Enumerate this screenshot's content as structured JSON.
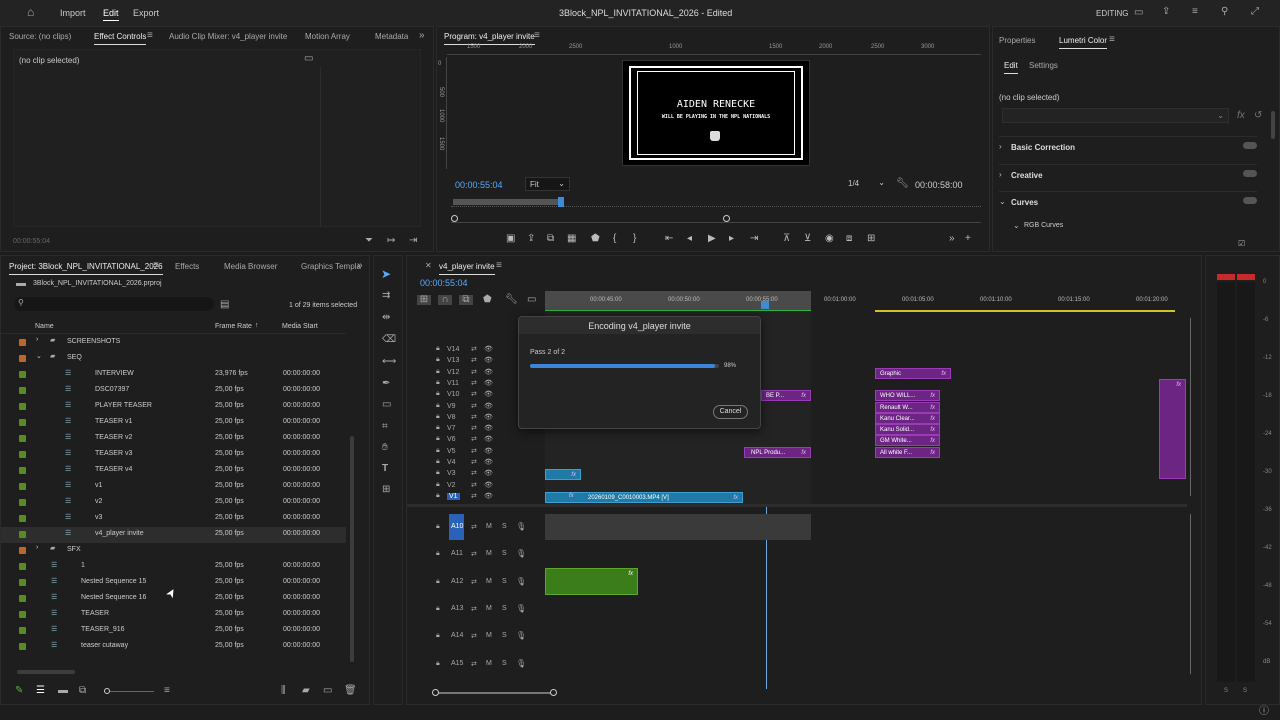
{
  "app": {
    "title": "3Block_NPL_INVITATIONAL_2026 - Edited",
    "menus": [
      "Import",
      "Edit",
      "Export"
    ],
    "active_menu": "Edit",
    "workspace": "EDITING"
  },
  "source_panel": {
    "tabs": [
      "Source: (no clips)",
      "Effect Controls",
      "Audio Clip Mixer: v4_player invite",
      "Motion Array",
      "Metadata"
    ],
    "active_tab": "Effect Controls",
    "empty_text": "(no clip selected)",
    "timecode": "00:00:55:04"
  },
  "program": {
    "tab": "Program: v4_player invite",
    "ruler": [
      "1500",
      "2000",
      "2500",
      "1000",
      "1500",
      "2000",
      "2500",
      "3000"
    ],
    "title_text": "AIDEN RENECKE",
    "subtitle_text": "WILL BE PLAYING IN THE NPL NATIONALS",
    "timecode_left": "00:00:55:04",
    "fit": "Fit",
    "quality": "1/4",
    "timecode_right": "00:00:58:00",
    "vruler": [
      "0",
      "500",
      "1000",
      "1500"
    ]
  },
  "lumetri": {
    "tabs": [
      "Properties",
      "Lumetri Color"
    ],
    "active_tab": "Lumetri Color",
    "subtabs": [
      "Edit",
      "Settings"
    ],
    "empty_text": "(no clip selected)",
    "sections": [
      "Basic Correction",
      "Creative",
      "Curves"
    ],
    "subsection": "RGB Curves"
  },
  "project": {
    "tabs": [
      "Project: 3Block_NPL_INVITATIONAL_2026",
      "Effects",
      "Media Browser",
      "Graphics Templa"
    ],
    "active_tab": "Project: 3Block_NPL_INVITATIONAL_2026",
    "file": "3Block_NPL_INVITATIONAL_2026.prproj",
    "items_selected": "1 of 29 items selected",
    "columns": [
      "Name",
      "Frame Rate",
      "Media Start"
    ],
    "rows": [
      {
        "name": "SCREENSHOTS",
        "type": "folder",
        "indent": 0,
        "fr": "",
        "ms": "",
        "color": "#c0662a"
      },
      {
        "name": "SEQ",
        "type": "folder-open",
        "indent": 0,
        "fr": "",
        "ms": "",
        "color": "#c0662a"
      },
      {
        "name": "INTERVIEW",
        "type": "seq",
        "indent": 2,
        "fr": "23,976 fps",
        "ms": "00:00:00:00",
        "color": "#5a8a26"
      },
      {
        "name": "DSC07397",
        "type": "seq",
        "indent": 2,
        "fr": "25,00 fps",
        "ms": "00:00:00:00",
        "color": "#5a8a26"
      },
      {
        "name": "PLAYER TEASER",
        "type": "seq",
        "indent": 2,
        "fr": "25,00 fps",
        "ms": "00:00:00:00",
        "color": "#5a8a26"
      },
      {
        "name": "TEASER v1",
        "type": "seq",
        "indent": 2,
        "fr": "25,00 fps",
        "ms": "00:00:00:00",
        "color": "#5a8a26"
      },
      {
        "name": "TEASER v2",
        "type": "seq",
        "indent": 2,
        "fr": "25,00 fps",
        "ms": "00:00:00:00",
        "color": "#5a8a26"
      },
      {
        "name": "TEASER v3",
        "type": "seq",
        "indent": 2,
        "fr": "25,00 fps",
        "ms": "00:00:00:00",
        "color": "#5a8a26"
      },
      {
        "name": "TEASER v4",
        "type": "seq",
        "indent": 2,
        "fr": "25,00 fps",
        "ms": "00:00:00:00",
        "color": "#5a8a26"
      },
      {
        "name": "v1",
        "type": "seq",
        "indent": 2,
        "fr": "25,00 fps",
        "ms": "00:00:00:00",
        "color": "#5a8a26"
      },
      {
        "name": "v2",
        "type": "seq",
        "indent": 2,
        "fr": "25,00 fps",
        "ms": "00:00:00:00",
        "color": "#5a8a26"
      },
      {
        "name": "v3",
        "type": "seq",
        "indent": 2,
        "fr": "25,00 fps",
        "ms": "00:00:00:00",
        "color": "#5a8a26"
      },
      {
        "name": "v4_player invite",
        "type": "seq",
        "indent": 2,
        "fr": "25,00 fps",
        "ms": "00:00:00:00",
        "color": "#5a8a26",
        "selected": true
      },
      {
        "name": "SFX",
        "type": "folder",
        "indent": 0,
        "fr": "",
        "ms": "",
        "color": "#c0662a"
      },
      {
        "name": "1",
        "type": "seq",
        "indent": 1,
        "fr": "25,00 fps",
        "ms": "00:00:00:00",
        "color": "#5a8a26"
      },
      {
        "name": "Nested Sequence 15",
        "type": "seq",
        "indent": 1,
        "fr": "25,00 fps",
        "ms": "00:00:00:00",
        "color": "#5a8a26"
      },
      {
        "name": "Nested Sequence 16",
        "type": "seq",
        "indent": 1,
        "fr": "25,00 fps",
        "ms": "00:00:00:00",
        "color": "#5a8a26"
      },
      {
        "name": "TEASER",
        "type": "seq",
        "indent": 1,
        "fr": "25,00 fps",
        "ms": "00:00:00:00",
        "color": "#5a8a26"
      },
      {
        "name": "TEASER_916",
        "type": "seq",
        "indent": 1,
        "fr": "25,00 fps",
        "ms": "00:00:00:00",
        "color": "#5a8a26"
      },
      {
        "name": "teaser cutaway",
        "type": "seq",
        "indent": 1,
        "fr": "25,00 fps",
        "ms": "00:00:00:00",
        "color": "#5a8a26"
      }
    ]
  },
  "timeline": {
    "tab": "v4_player invite",
    "timecode": "00:00:55:04",
    "ruler": [
      "00:00:45:00",
      "00:00:50:00",
      "00:00:55:00",
      "00:01:00:00",
      "00:01:05:00",
      "00:01:10:00",
      "00:01:15:00",
      "00:01:20:00"
    ],
    "video_tracks": [
      "V14",
      "V13",
      "V12",
      "V11",
      "V10",
      "V9",
      "V8",
      "V7",
      "V6",
      "V5",
      "V4",
      "V3",
      "V2",
      "V1"
    ],
    "audio_tracks": [
      "A10",
      "A11",
      "A12",
      "A13",
      "A14",
      "A15"
    ],
    "clips": {
      "graphic": "Graphic",
      "who": "WHO WILL...",
      "renault": "Renault W...",
      "kanu1": "Kanu Clear...",
      "kanu2": "Kanu Solid...",
      "gm": "GM White...",
      "allwhite": "All white F...",
      "npl": "NPL Produ...",
      "bep": "BE P...",
      "main": "20260109_C0010003.MP4 [V]",
      "fx": "fx"
    }
  },
  "encoding": {
    "title": "Encoding v4_player invite",
    "pass": "Pass 2 of 2",
    "percent": "98%",
    "progress": 0.98,
    "cancel": "Cancel"
  },
  "meter": {
    "scale": [
      "0",
      "-6",
      "-12",
      "-18",
      "-24",
      "-30",
      "-36",
      "-42",
      "-48",
      "-54",
      "dB"
    ],
    "bottom": [
      "S",
      "S"
    ]
  }
}
